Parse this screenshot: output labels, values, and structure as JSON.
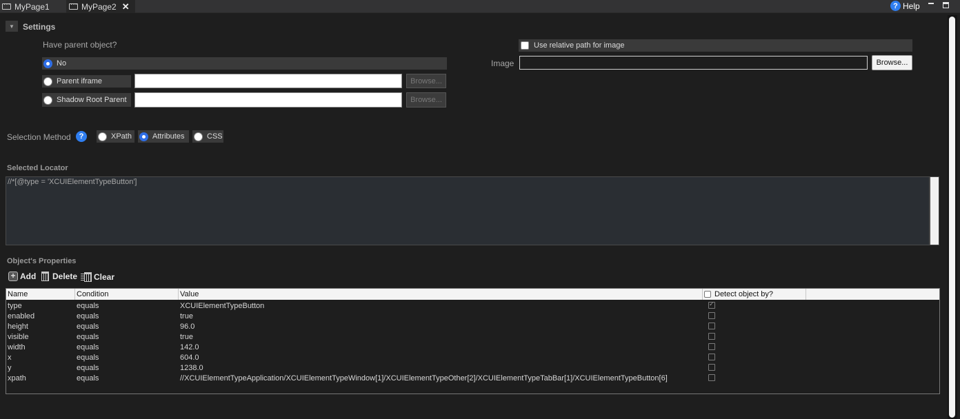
{
  "tabs": [
    {
      "label": "MyPage1",
      "active": false
    },
    {
      "label": "MyPage2",
      "active": true,
      "closable": true
    }
  ],
  "window": {
    "help_label": "Help"
  },
  "settings": {
    "title": "Settings",
    "parent_question": "Have parent object?",
    "parent_options": [
      {
        "label": "No",
        "selected": true
      },
      {
        "label": "Parent iframe",
        "selected": false,
        "value": "",
        "browse_label": "Browse..."
      },
      {
        "label": "Shadow Root Parent",
        "selected": false,
        "value": "",
        "browse_label": "Browse..."
      }
    ],
    "relative_path_label": "Use relative path for image",
    "relative_path_checked": false,
    "image_label": "Image",
    "image_value": "",
    "image_browse_label": "Browse..."
  },
  "selection_method": {
    "label": "Selection Method",
    "options": [
      {
        "label": "XPath",
        "selected": false
      },
      {
        "label": "Attributes",
        "selected": true
      },
      {
        "label": "CSS",
        "selected": false
      }
    ]
  },
  "locator": {
    "title": "Selected Locator",
    "value": "//*[@type = 'XCUIElementTypeButton']"
  },
  "properties": {
    "title": "Object's Properties",
    "actions": {
      "add": "Add",
      "delete": "Delete",
      "clear": "Clear"
    },
    "columns": {
      "name": "Name",
      "condition": "Condition",
      "value": "Value",
      "detect": "Detect object by?"
    },
    "rows": [
      {
        "name": "type",
        "condition": "equals",
        "value": "XCUIElementTypeButton",
        "detect": true
      },
      {
        "name": "enabled",
        "condition": "equals",
        "value": "true",
        "detect": false
      },
      {
        "name": "height",
        "condition": "equals",
        "value": "96.0",
        "detect": false
      },
      {
        "name": "visible",
        "condition": "equals",
        "value": "true",
        "detect": false
      },
      {
        "name": "width",
        "condition": "equals",
        "value": "142.0",
        "detect": false
      },
      {
        "name": "x",
        "condition": "equals",
        "value": "604.0",
        "detect": false
      },
      {
        "name": "y",
        "condition": "equals",
        "value": "1238.0",
        "detect": false
      },
      {
        "name": "xpath",
        "condition": "equals",
        "value": "//XCUIElementTypeApplication/XCUIElementTypeWindow[1]/XCUIElementTypeOther[2]/XCUIElementTypeTabBar[1]/XCUIElementTypeButton[6]",
        "detect": false
      }
    ]
  },
  "colors": {
    "accent": "#2f6ee6",
    "background": "#1e1e1e",
    "panel": "#3a3a3a"
  }
}
